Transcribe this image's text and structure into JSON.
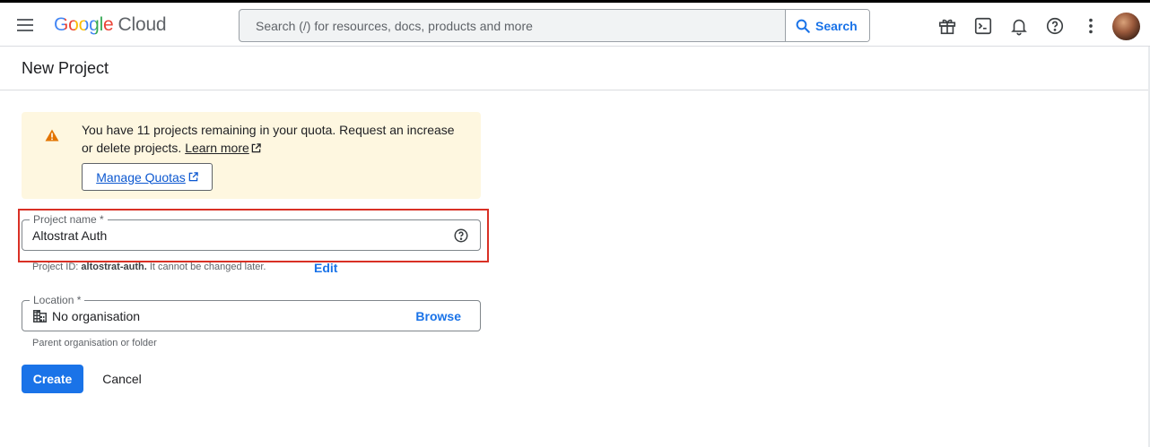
{
  "header": {
    "logo": {
      "google": "Google",
      "cloud": "Cloud"
    },
    "search": {
      "placeholder": "Search (/) for resources, docs, products and more",
      "button_label": "Search"
    }
  },
  "page": {
    "title": "New Project"
  },
  "quota_banner": {
    "text": "You have 11 projects remaining in your quota. Request an increase or delete projects.",
    "learn_more": "Learn more",
    "manage_button": "Manage Quotas"
  },
  "project_name": {
    "label": "Project name *",
    "value": "Altostrat Auth",
    "id_prefix": "Project ID:",
    "id_value": "altostrat-auth.",
    "id_suffix": "It cannot be changed later.",
    "edit_label": "Edit"
  },
  "location": {
    "label": "Location *",
    "value": "No organisation",
    "browse_label": "Browse",
    "hint": "Parent organisation or folder"
  },
  "actions": {
    "create": "Create",
    "cancel": "Cancel"
  },
  "colors": {
    "accent": "#1a73e8",
    "banner_bg": "#fef7e0",
    "warning": "#e37400",
    "highlight_border": "#d93025"
  }
}
